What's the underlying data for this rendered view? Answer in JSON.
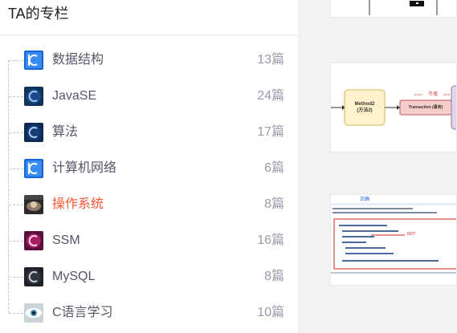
{
  "sidebar": {
    "title": "TA的专栏",
    "items": [
      {
        "label": "数据结构",
        "count": "13篇",
        "icon": "column-thumb-blue-c"
      },
      {
        "label": "JavaSE",
        "count": "24篇",
        "icon": "column-thumb-dark-c"
      },
      {
        "label": "算法",
        "count": "17篇",
        "icon": "column-thumb-navy-c"
      },
      {
        "label": "计算机网络",
        "count": "6篇",
        "icon": "column-thumb-blue-c"
      },
      {
        "label": "操作系统",
        "count": "8篇",
        "icon": "column-thumb-photo"
      },
      {
        "label": "SSM",
        "count": "16篇",
        "icon": "column-thumb-magenta-c"
      },
      {
        "label": "MySQL",
        "count": "8篇",
        "icon": "column-thumb-gray-c"
      },
      {
        "label": "C语言学习",
        "count": "10篇",
        "icon": "column-thumb-eye"
      }
    ],
    "active_color": "#fc5531"
  },
  "feed": {
    "diagram": {
      "node1_line1": "Method2",
      "node1_line2": "(方法2)",
      "arrow_label": "传播",
      "node2": "Transaction (事务)"
    },
    "code_card": {
      "badge": "正确",
      "note": "NOT"
    }
  }
}
